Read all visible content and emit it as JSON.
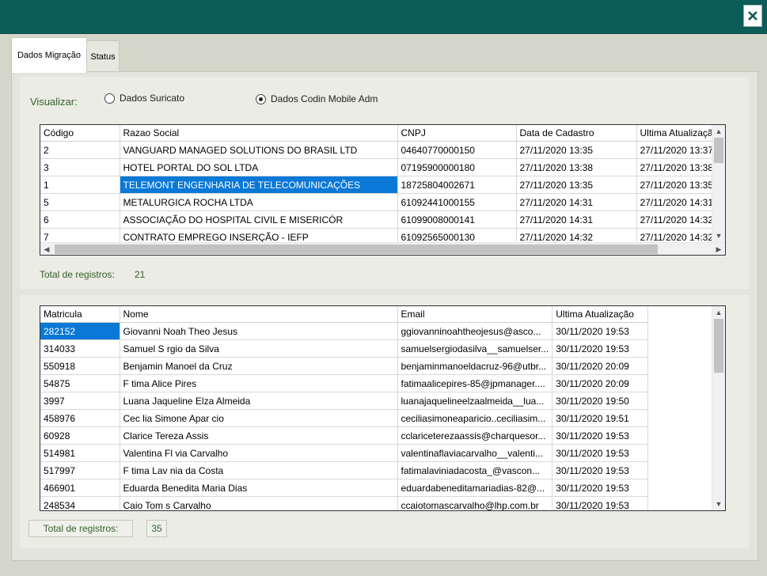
{
  "close_icon": "close-x-icon",
  "tabs": [
    "Dados Migração",
    "Status"
  ],
  "visualizar": {
    "label": "Visualizar:",
    "options": [
      "Dados Suricato",
      "Dados Codin Mobile Adm"
    ],
    "selected": "Dados Codin Mobile Adm"
  },
  "grid1": {
    "headers": [
      "Código",
      "Razao Social",
      "CNPJ",
      "Data de Cadastro",
      "Ultima Atualização"
    ],
    "rows": [
      [
        "2",
        "VANGUARD MANAGED SOLUTIONS DO BRASIL LTD",
        "04640770000150",
        "27/11/2020 13:35",
        "27/11/2020 13:37"
      ],
      [
        "3",
        "HOTEL PORTAL DO SOL LTDA",
        "07195900000180",
        "27/11/2020 13:38",
        "27/11/2020 13:38"
      ],
      [
        "1",
        "TELEMONT ENGENHARIA DE TELECOMUNICAÇÕES",
        "18725804002671",
        "27/11/2020 13:35",
        "27/11/2020 13:35"
      ],
      [
        "5",
        "METALURGICA ROCHA LTDA",
        "61092441000155",
        "27/11/2020 14:31",
        "27/11/2020 14:31"
      ],
      [
        "6",
        "ASSOCIAÇÃO DO HOSPITAL CIVIL E MISERICÓR",
        "61099008000141",
        "27/11/2020 14:31",
        "27/11/2020 14:32"
      ],
      [
        "7",
        "CONTRATO EMPREGO INSERÇÃO - IEFP",
        "61092565000130",
        "27/11/2020 14:32",
        "27/11/2020 14:32"
      ]
    ],
    "selected": {
      "row": 2,
      "col": 1
    },
    "total_label": "Total de registros:",
    "total_value": "21"
  },
  "grid2": {
    "headers": [
      "Matricula",
      "Nome",
      "Email",
      "Ultima Atualização"
    ],
    "rows": [
      [
        "282152",
        "Giovanni Noah Theo Jesus",
        "ggiovanninoahtheojesus@asco...",
        "30/11/2020 19:53"
      ],
      [
        "314033",
        "Samuel S rgio da Silva",
        "samuelsergiodasilva__samuelser...",
        "30/11/2020 19:53"
      ],
      [
        "550918",
        "Benjamin Manoel da Cruz",
        "benjaminmanoeldacruz-96@utbr...",
        "30/11/2020 20:09"
      ],
      [
        "54875",
        "F tima Alice Pires",
        "fatimaalicepires-85@jpmanager....",
        "30/11/2020 20:09"
      ],
      [
        "3997",
        "Luana Jaqueline Elza Almeida",
        "luanajaquelineelzaalmeida__lua...",
        "30/11/2020 19:50"
      ],
      [
        "458976",
        "Cec lia Simone Apar cio",
        "ceciliasimoneaparicio..ceciliasim...",
        "30/11/2020 19:51"
      ],
      [
        "60928",
        "Clarice Tereza Assis",
        "cclariceterezaassis@charquesor...",
        "30/11/2020 19:53"
      ],
      [
        "514981",
        "Valentina Fl via Carvalho",
        "valentinaflaviacarvalho__valenti...",
        "30/11/2020 19:53"
      ],
      [
        "517997",
        "F tima Lav nia da Costa",
        "fatimalaviniadacosta_@vascon...",
        "30/11/2020 19:53"
      ],
      [
        "466901",
        "Eduarda Benedita Maria Dias",
        "eduardabeneditamariadias-82@...",
        "30/11/2020 19:53"
      ],
      [
        "248534",
        "Caio Tom s Carvalho",
        "ccaiotomascarvalho@lhp.com.br",
        "30/11/2020 19:53"
      ]
    ],
    "selected": {
      "row": 0,
      "col": 0
    },
    "total_label": "Total de registros:",
    "total_value": "35"
  }
}
